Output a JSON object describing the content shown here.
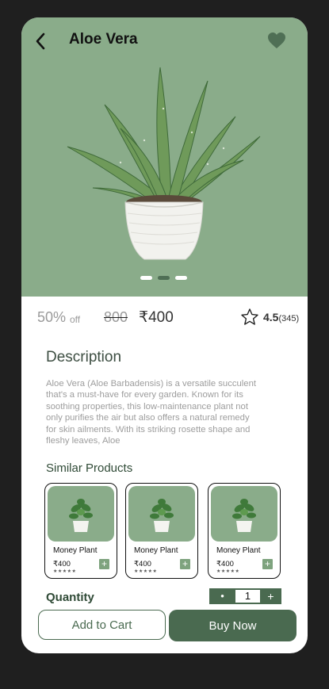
{
  "header": {
    "title": "Aloe Vera"
  },
  "colors": {
    "hero_bg": "#8aac8a",
    "primary": "#4a6a50",
    "heart": "#4f6f55"
  },
  "carousel": {
    "dot_count": 3,
    "active_index": 1
  },
  "pricing": {
    "discount": "50%",
    "off_label": "off",
    "original_price": "800",
    "price": "₹400"
  },
  "rating": {
    "value": "4.5",
    "count": "(345)"
  },
  "description": {
    "title": "Description",
    "text": "Aloe Vera (Aloe Barbadensis) is a versatile succulent that's a must-have for every garden. Known for its soothing properties, this low-maintenance plant not only purifies the air but also offers a natural remedy for skin ailments. With its striking rosette shape and fleshy leaves, Aloe"
  },
  "similar": {
    "title": "Similar Products",
    "products": [
      {
        "name": "Money Plant",
        "price": "₹400",
        "stars": "★★★★★"
      },
      {
        "name": "Money Plant",
        "price": "₹400",
        "stars": "★★★★★"
      },
      {
        "name": "Money Plant",
        "price": "₹400",
        "stars": "★★★★★"
      }
    ]
  },
  "quantity": {
    "label": "Quantity",
    "value": "1",
    "minus": "•",
    "plus": "+"
  },
  "actions": {
    "add_to_cart": "Add to Cart",
    "buy_now": "Buy Now"
  }
}
